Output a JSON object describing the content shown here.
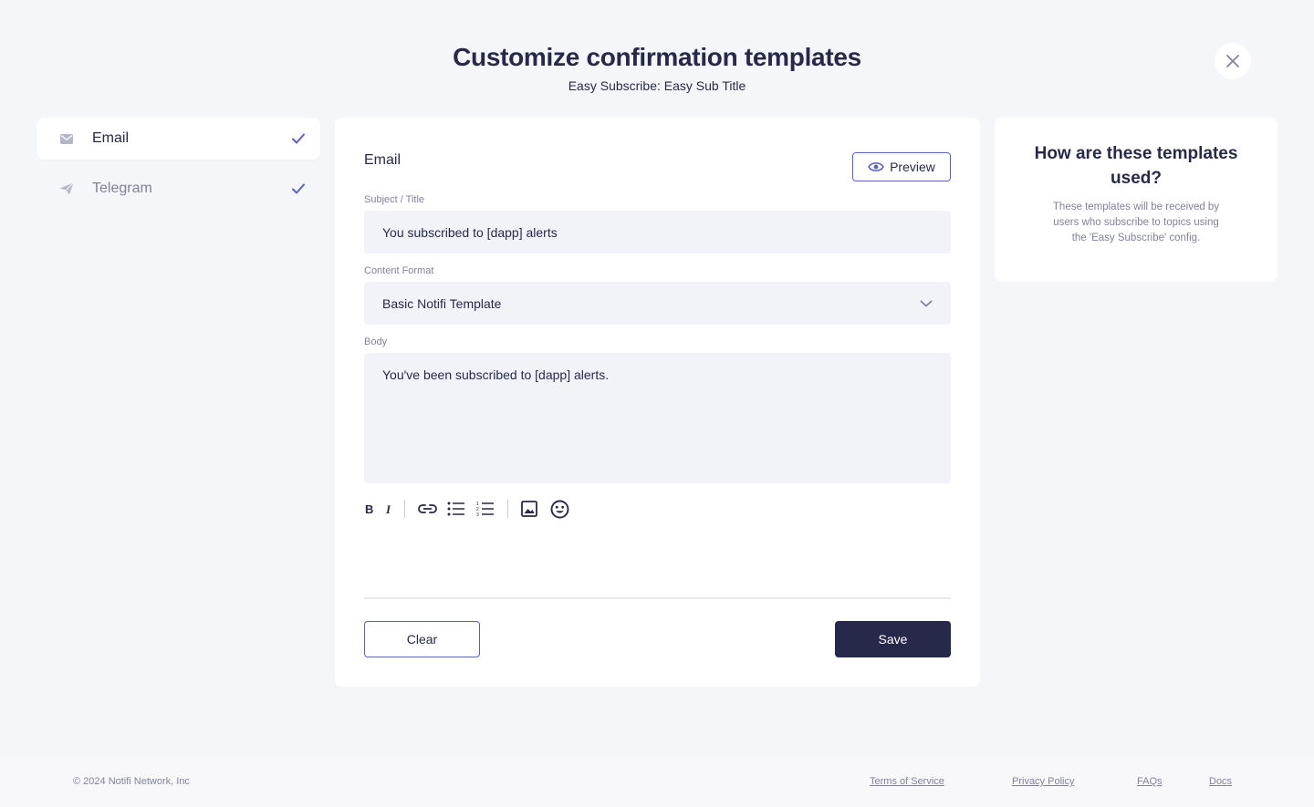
{
  "header": {
    "title": "Customize confirmation templates",
    "subtitle": "Easy Subscribe: Easy Sub Title"
  },
  "nav": {
    "items": [
      {
        "label": "Email",
        "icon": "envelope-icon",
        "active": true,
        "completed": true
      },
      {
        "label": "Telegram",
        "icon": "paper-plane-icon",
        "active": false,
        "completed": true
      }
    ]
  },
  "editor": {
    "heading": "Email",
    "preview_label": "Preview",
    "subject_label": "Subject / Title",
    "subject_value": "You subscribed to [dapp] alerts",
    "format_label": "Content Format",
    "format_value": "Basic Notifi Template",
    "body_label": "Body",
    "body_value": "You've been subscribed to [dapp] alerts.",
    "toolbar": [
      "bold-icon",
      "italic-icon",
      "link-icon",
      "bullet-list-icon",
      "numbered-list-icon",
      "image-icon",
      "emoji-icon"
    ],
    "clear_label": "Clear",
    "save_label": "Save"
  },
  "info": {
    "title": "How are these templates used?",
    "text": "These templates will be received by users who subscribe to topics using the 'Easy Subscribe' config."
  },
  "footer": {
    "copyright": "© 2024 Notifi Network, Inc",
    "links": [
      "Terms of Service",
      "Privacy Policy",
      "FAQs",
      "Docs"
    ]
  },
  "colors": {
    "background": "#f5f6fa",
    "primary_dark": "#262949",
    "accent": "#5a5fc7",
    "muted_text": "#80829d",
    "field_bg": "#f2f3f8"
  }
}
